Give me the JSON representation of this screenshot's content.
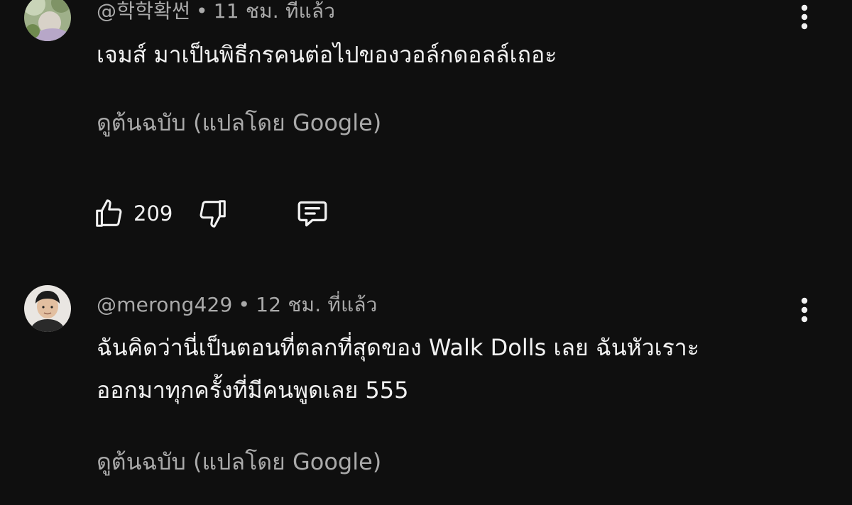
{
  "comments": [
    {
      "author": "@학학확썬",
      "separator": "•",
      "time": "11 ชม. ที่แล้ว",
      "lines": [
        "เจมส์ มาเป็นพิธีกรคนต่อไปของวอล์กดอลล์เถอะ"
      ],
      "translate_label": "ดูต้นฉบับ (แปลโดย Google)",
      "like_count": "209",
      "avatar_icon": "avatar-garden-icon",
      "menu_icon": "more-vertical-icon"
    },
    {
      "author": "@merong429",
      "separator": "•",
      "time": "12 ชม. ที่แล้ว",
      "lines": [
        "ฉันคิดว่านี่เป็นตอนที่ตลกที่สุดของ Walk Dolls เลย ฉันหัวเราะ",
        "ออกมาทุกครั้งที่มีคนพูดเลย 555"
      ],
      "translate_label": "ดูต้นฉบับ (แปลโดย Google)",
      "avatar_icon": "avatar-person-icon",
      "menu_icon": "more-vertical-icon"
    }
  ],
  "icons": {
    "like": "thumb-up-icon",
    "dislike": "thumb-down-icon",
    "reply": "reply-comment-icon"
  },
  "colors": {
    "background": "#0f0f0f",
    "primary_text": "#f1f1f1",
    "secondary_text": "#aaaaaa"
  }
}
